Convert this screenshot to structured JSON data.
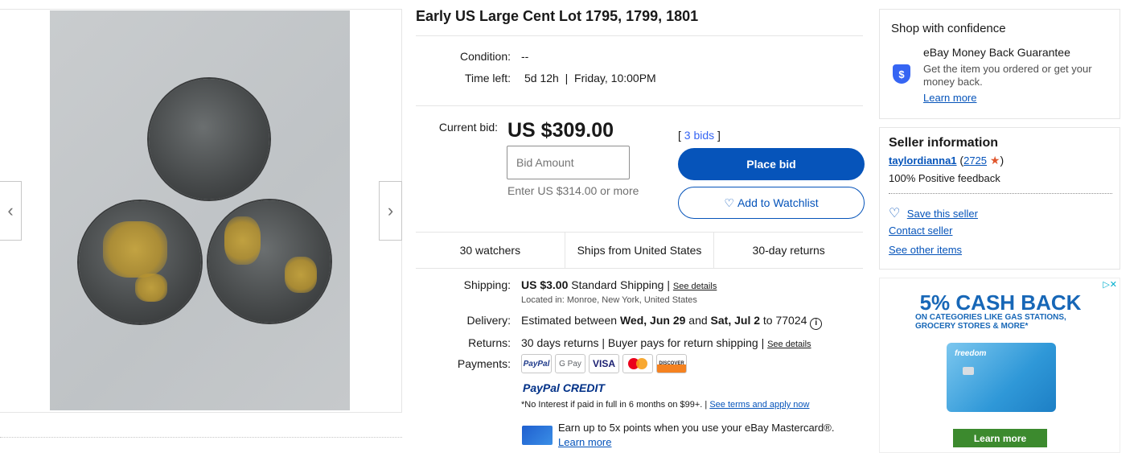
{
  "listing": {
    "title": "Early US Large Cent Lot 1795, 1799, 1801"
  },
  "details": {
    "condition_label": "Condition:",
    "condition_value": "--",
    "time_left_label": "Time left:",
    "time_left_value": "5d 12h",
    "time_left_end": "Friday, 10:00PM"
  },
  "bid": {
    "current_label": "Current bid:",
    "price": "US $309.00",
    "bids_count": "3 bids",
    "input_placeholder": "Bid Amount",
    "hint": "Enter US $314.00 or more",
    "place_bid": "Place bid",
    "watchlist": "Add to Watchlist"
  },
  "stats": {
    "watchers": "30 watchers",
    "ships_from": "Ships from United States",
    "returns": "30-day returns"
  },
  "shipping": {
    "label": "Shipping:",
    "price": "US $3.00",
    "method": "Standard Shipping",
    "see_details": "See details",
    "located": "Located in: Monroe, New York, United States"
  },
  "delivery": {
    "label": "Delivery:",
    "prefix": "Estimated between",
    "date1": "Wed, Jun 29",
    "and": "and",
    "date2": "Sat, Jul 2",
    "to": "to 77024"
  },
  "returns": {
    "label": "Returns:",
    "text": "30 days returns | Buyer pays for return shipping |",
    "see_details": "See details"
  },
  "payments": {
    "label": "Payments:",
    "methods": [
      "PayPal",
      "G Pay",
      "VISA",
      "Mastercard",
      "DISCOVER"
    ],
    "paypal_credit": "PayPal CREDIT",
    "credit_note": "*No Interest if paid in full in 6 months on $99+. |",
    "credit_link": "See terms and apply now",
    "mastercard_promo": "Earn up to 5x points when you use your eBay Mastercard®.",
    "mastercard_link": "Learn more"
  },
  "confidence": {
    "title": "Shop with confidence",
    "guarantee_title": "eBay Money Back Guarantee",
    "guarantee_text": "Get the item you ordered or get your money back.",
    "learn_more": "Learn more"
  },
  "seller": {
    "title": "Seller information",
    "name": "taylordianna1",
    "score": "2725",
    "feedback": "100% Positive feedback",
    "save": "Save this seller",
    "contact": "Contact seller",
    "other": "See other items"
  },
  "ad": {
    "headline": "5% CASH BACK",
    "subline": "ON CATEGORIES LIKE GAS STATIONS, GROCERY STORES & MORE*",
    "card_brand": "freedom",
    "cta": "Learn more"
  },
  "colors": {
    "primary": "#0654ba",
    "link": "#3665f3",
    "ad_blue": "#1767b7",
    "ad_green": "#3c8a2e"
  }
}
